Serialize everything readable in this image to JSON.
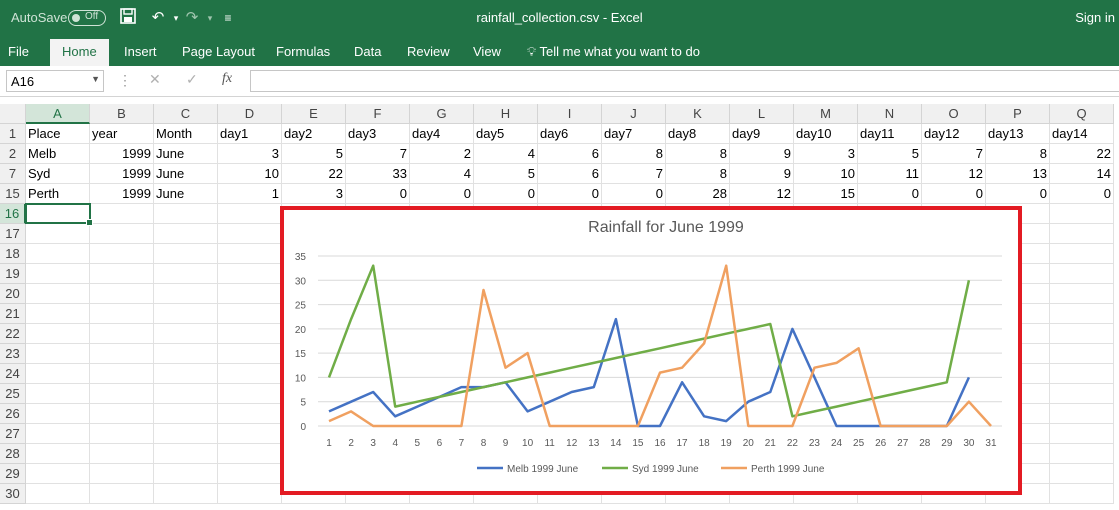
{
  "app": {
    "autosave_label": "AutoSave",
    "autosave_state": "Off",
    "doc_title": "rainfall_collection.csv  -  Excel",
    "signin": "Sign in"
  },
  "ribbon": {
    "tabs": [
      "File",
      "Home",
      "Insert",
      "Page Layout",
      "Formulas",
      "Data",
      "Review",
      "View"
    ],
    "active_tab": "Home",
    "tell_me": "Tell me what you want to do"
  },
  "formula_bar": {
    "name_box": "A16",
    "formula": ""
  },
  "sheet": {
    "columns": [
      "A",
      "B",
      "C",
      "D",
      "E",
      "F",
      "G",
      "H",
      "I",
      "J",
      "K",
      "L",
      "M",
      "N",
      "O",
      "P",
      "Q"
    ],
    "selected_column": "A",
    "selected_row": "16",
    "rows": [
      {
        "num": "1",
        "cells": [
          "Place",
          "year",
          "Month",
          "day1",
          "day2",
          "day3",
          "day4",
          "day5",
          "day6",
          "day7",
          "day8",
          "day9",
          "day10",
          "day11",
          "day12",
          "day13",
          "day14"
        ]
      },
      {
        "num": "2",
        "cells": [
          "Melb",
          "1999",
          "June",
          "3",
          "5",
          "7",
          "2",
          "4",
          "6",
          "8",
          "8",
          "9",
          "3",
          "5",
          "7",
          "8",
          "22"
        ]
      },
      {
        "num": "7",
        "cells": [
          "Syd",
          "1999",
          "June",
          "10",
          "22",
          "33",
          "4",
          "5",
          "6",
          "7",
          "8",
          "9",
          "10",
          "11",
          "12",
          "13",
          "14"
        ]
      },
      {
        "num": "15",
        "cells": [
          "Perth",
          "1999",
          "June",
          "1",
          "3",
          "0",
          "0",
          "0",
          "0",
          "0",
          "28",
          "12",
          "15",
          "0",
          "0",
          "0",
          "0"
        ]
      },
      {
        "num": "16",
        "cells": []
      },
      {
        "num": "17",
        "cells": []
      },
      {
        "num": "18",
        "cells": []
      },
      {
        "num": "19",
        "cells": []
      },
      {
        "num": "20",
        "cells": []
      },
      {
        "num": "21",
        "cells": []
      },
      {
        "num": "22",
        "cells": []
      },
      {
        "num": "23",
        "cells": []
      },
      {
        "num": "24",
        "cells": []
      },
      {
        "num": "25",
        "cells": []
      },
      {
        "num": "26",
        "cells": []
      },
      {
        "num": "27",
        "cells": []
      },
      {
        "num": "28",
        "cells": []
      },
      {
        "num": "29",
        "cells": []
      },
      {
        "num": "30",
        "cells": []
      }
    ]
  },
  "colors": {
    "excel_green": "#217346",
    "highlight_border": "#e31b23",
    "melb": "#4472c4",
    "syd": "#70ad47",
    "perth": "#f4a460"
  },
  "chart_data": {
    "type": "line",
    "title": "Rainfall for June 1999",
    "x": [
      1,
      2,
      3,
      4,
      5,
      6,
      7,
      8,
      9,
      10,
      11,
      12,
      13,
      14,
      15,
      16,
      17,
      18,
      19,
      20,
      21,
      22,
      23,
      24,
      25,
      26,
      27,
      28,
      29,
      30,
      31
    ],
    "ylim": [
      0,
      35
    ],
    "yticks": [
      0,
      5,
      10,
      15,
      20,
      25,
      30,
      35
    ],
    "grid": true,
    "legend_position": "bottom",
    "series": [
      {
        "name": "Melb 1999 June",
        "color": "#4472c4",
        "values": [
          3,
          5,
          7,
          2,
          4,
          6,
          8,
          8,
          9,
          3,
          5,
          7,
          8,
          22,
          0,
          0,
          9,
          2,
          1,
          5,
          7,
          20,
          10,
          0,
          0,
          0,
          0,
          0,
          0,
          10,
          null
        ]
      },
      {
        "name": "Syd 1999 June",
        "color": "#70ad47",
        "values": [
          10,
          22,
          33,
          4,
          5,
          6,
          7,
          8,
          9,
          10,
          11,
          12,
          13,
          14,
          15,
          16,
          17,
          18,
          19,
          20,
          21,
          2,
          3,
          4,
          5,
          6,
          7,
          8,
          9,
          30,
          null
        ]
      },
      {
        "name": "Perth 1999 June",
        "color": "#f0a060",
        "values": [
          1,
          3,
          0,
          0,
          0,
          0,
          0,
          28,
          12,
          15,
          0,
          0,
          0,
          0,
          0,
          11,
          12,
          17,
          33,
          0,
          0,
          0,
          12,
          13,
          16,
          0,
          0,
          0,
          0,
          5,
          0
        ]
      }
    ]
  }
}
